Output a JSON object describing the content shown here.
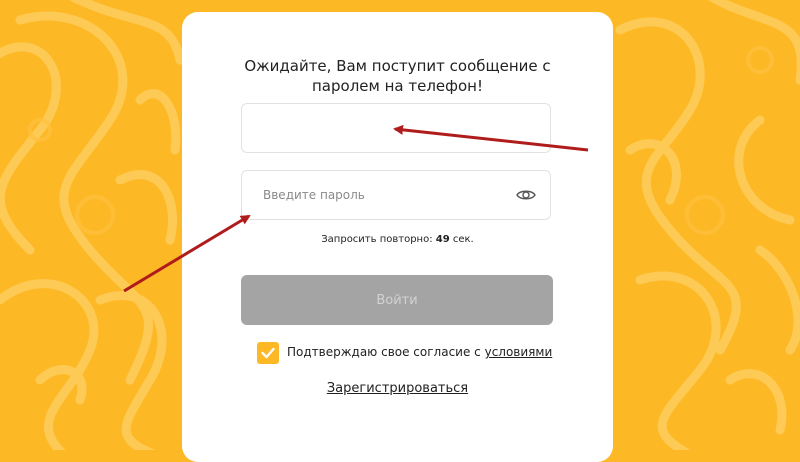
{
  "colors": {
    "background": "#FDB826",
    "card": "#ffffff",
    "button_disabled": "#a4a4a4",
    "checkbox": "#FDB826",
    "annotation_arrow": "#b01c1c"
  },
  "form": {
    "title_line1": "Ожидайте, Вам поступит сообщение с",
    "title_line2": "паролем на телефон!",
    "phone_value": "",
    "password_placeholder": "Введите пароль",
    "resend_prefix": "Запросить повторно: ",
    "resend_seconds": "49",
    "resend_unit": " сек.",
    "login_label": "Войти",
    "consent_text": "Подтверждаю свое согласие с ",
    "consent_link": "условиями",
    "consent_checked": true,
    "register_label": "Зарегистрироваться"
  },
  "icons": {
    "eye": "eye-icon",
    "check": "checkmark-icon"
  }
}
